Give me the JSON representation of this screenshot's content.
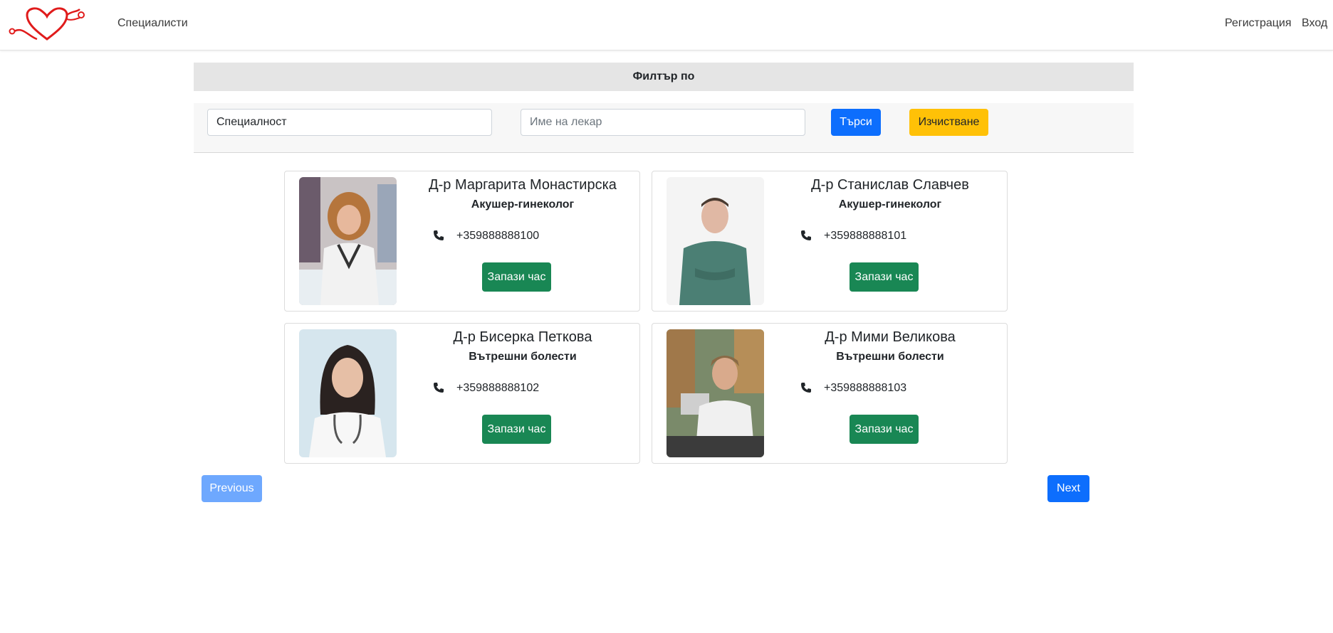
{
  "navbar": {
    "logo_icon": "heart-stethoscope-icon",
    "specialists_label": "Специалисти",
    "register_label": "Регистрация",
    "login_label": "Вход"
  },
  "filter": {
    "title": "Филтър по",
    "specialty_value": "Специалност",
    "doctor_placeholder": "Име на лекар",
    "search_label": "Търси",
    "clear_label": "Изчистване"
  },
  "doctors": [
    {
      "name": "Д-р Маргарита Монастирска",
      "specialty": "Акушер-гинеколог",
      "phone": "+359888888100",
      "book_label": "Запази час"
    },
    {
      "name": "Д-р Станислав Славчев",
      "specialty": "Акушер-гинеколог",
      "phone": "+359888888101",
      "book_label": "Запази час"
    },
    {
      "name": "Д-р Бисерка Петкова",
      "specialty": "Вътрешни болести",
      "phone": "+359888888102",
      "book_label": "Запази час"
    },
    {
      "name": "Д-р Мими Великова",
      "specialty": "Вътрешни болести",
      "phone": "+359888888103",
      "book_label": "Запази час"
    }
  ],
  "pagination": {
    "previous_label": "Previous",
    "next_label": "Next"
  },
  "colors": {
    "primary": "#0d6efd",
    "warning": "#ffc107",
    "success": "#198754",
    "logo_red": "#e01b1b"
  }
}
